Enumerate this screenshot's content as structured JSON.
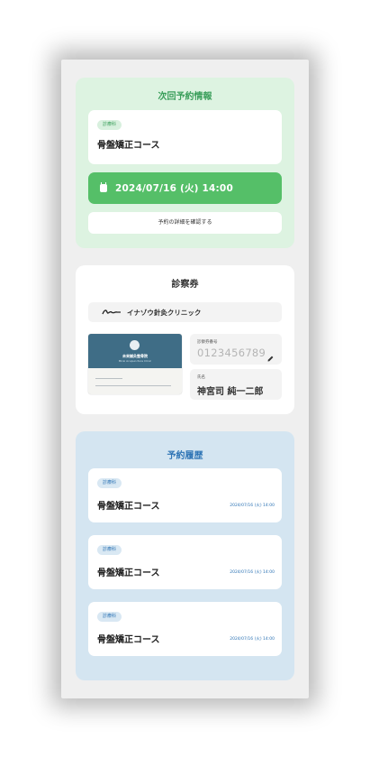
{
  "next_reservation": {
    "title": "次回予約情報",
    "badge": "診療科",
    "course": "骨盤矯正コース",
    "datetime": "2024/07/16 (火) 14:00",
    "detail_button": "予約の詳細を確認する"
  },
  "ticket": {
    "title": "診察券",
    "clinic_name": "イナゾウ針灸クリニック",
    "card_image": {
      "name": "未来鍼灸整骨院",
      "subtitle": "Mirai Acupuncture Clinic"
    },
    "number_label": "診察券番号",
    "number_value": "0123456789",
    "name_label": "氏名",
    "name_value": "神宮司 純一二郎"
  },
  "history": {
    "title": "予約履歴",
    "items": [
      {
        "badge": "診療科",
        "course": "骨盤矯正コース",
        "datetime": "2024/07/16 (火) 14:00"
      },
      {
        "badge": "診療科",
        "course": "骨盤矯正コース",
        "datetime": "2024/07/16 (火) 14:00"
      },
      {
        "badge": "診療科",
        "course": "骨盤矯正コース",
        "datetime": "2024/07/16 (火) 14:00"
      }
    ]
  },
  "colors": {
    "green_accent": "#55bf68",
    "green_bg": "#ddf3e1",
    "blue_bg": "#d4e5f1",
    "blue_text": "#2e74b5"
  }
}
